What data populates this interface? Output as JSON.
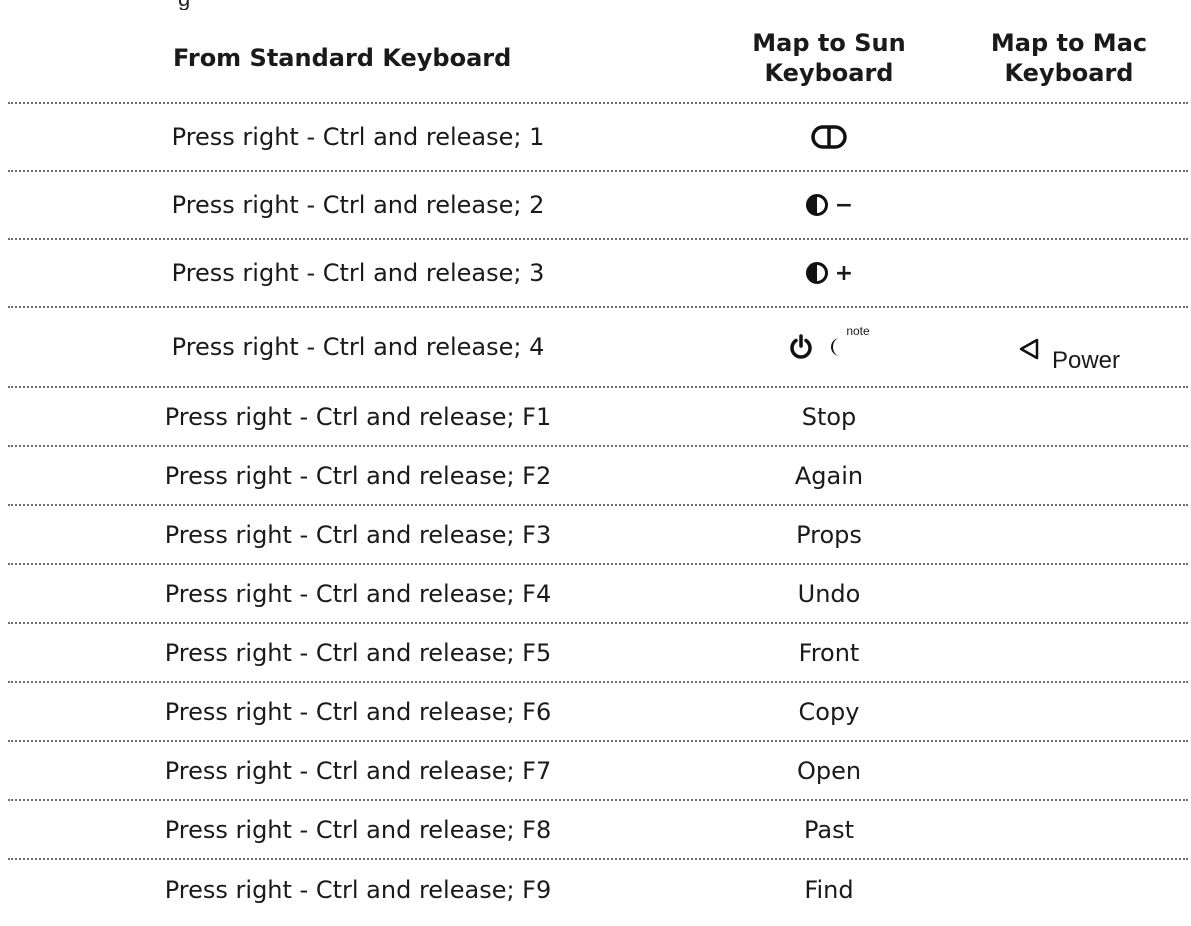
{
  "clipped_caption": "g",
  "table": {
    "headers": {
      "col1": "From Standard Keyboard",
      "col2_line1": "Map to Sun",
      "col2_line2": "Keyboard",
      "col3_line1": "Map to Mac",
      "col3_line2": "Keyboard"
    },
    "rows": [
      {
        "from": "Press right - Ctrl and release; 1",
        "sun_icon": "mute-icon"
      },
      {
        "from": "Press right - Ctrl and release; 2",
        "sun_icon": "volume-down-icon",
        "sun_suffix": "−"
      },
      {
        "from": "Press right - Ctrl and release; 3",
        "sun_icon": "volume-up-icon",
        "sun_suffix": "+"
      },
      {
        "from": "Press right - Ctrl and release; 4",
        "sun_icon": "power-icon",
        "sun_icon2": "sleep-moon-icon",
        "sun_note": "note",
        "mac_icon": "power-triangle-icon",
        "mac": "Power"
      },
      {
        "from": "Press right - Ctrl and release; F1",
        "sun": "Stop"
      },
      {
        "from": "Press right - Ctrl and release; F2",
        "sun": "Again"
      },
      {
        "from": "Press right - Ctrl and release; F3",
        "sun": "Props"
      },
      {
        "from": "Press right - Ctrl and release; F4",
        "sun": "Undo"
      },
      {
        "from": "Press right - Ctrl and release; F5",
        "sun": "Front"
      },
      {
        "from": "Press right - Ctrl and release; F6",
        "sun": "Copy"
      },
      {
        "from": "Press right - Ctrl and release; F7",
        "sun": "Open"
      },
      {
        "from": "Press right - Ctrl and release; F8",
        "sun": "Past"
      },
      {
        "from": "Press right - Ctrl and release; F9",
        "sun": "Find"
      }
    ]
  }
}
